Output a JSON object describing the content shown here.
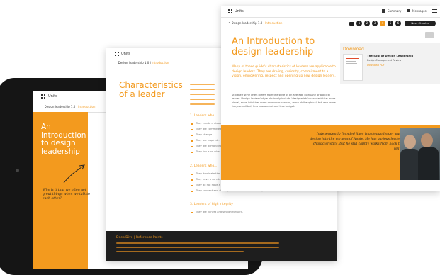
{
  "tablet": {
    "menu_label": "Units",
    "breadcrumb_course": "Design leadership 1.0",
    "breadcrumb_sep": "|",
    "breadcrumb_page": "Introduction",
    "hero_title": "An introduction to design leadership",
    "quote": "Why is it that we often get great things when we talk to each other?"
  },
  "middle": {
    "menu_label": "Units",
    "breadcrumb_course": "Design leadership 1.0",
    "breadcrumb_page": "Introduction",
    "title": "Characteristics of a leader",
    "section_1": "1. Leaders who...",
    "section_2": "2. Leaders who...",
    "section_3": "3. Leaders of high integrity",
    "footer_heading": "Deep Dive | Reference Points",
    "bullets_1": [
      "They create a vision...",
      "They are committed...",
      "They change...",
      "They are inspired...",
      "They are demanding...",
      "They focus on what..."
    ],
    "bullets_2": [
      "They dominate the...",
      "They have a can-do attitude and never shy away from a new challenge.",
      "They do not have a rigid mentality — wanting time on any things can't get done.",
      "They connect and develop with others to expand capabilities and effectiveness."
    ],
    "bullets_3": [
      "They are honest and straightforward."
    ]
  },
  "front": {
    "menu_label": "Units",
    "summary_label": "Summary",
    "messages_label": "Messages",
    "breadcrumb_course": "Design leadership 1.0",
    "breadcrumb_page": "Introduction",
    "title": "An Introduction to design leadership",
    "lead": "Many of these guide's characteristics of leaders are applicable to design leaders. They are driving, curiosity, commitment to a vision, empowering, respect and opening up new design leaders.",
    "body": "Still their style often differs from the style of an average company or political leader. Design leaders' style obviously include 'designerish' characteristics: more visual, more intuitive, more consumer-centred, more philosophical, but also more fun, committed, less economical and less budget.",
    "download_label": "Download",
    "book_title": "The Soul of Design Leadership",
    "book_sub": "Design Management Review",
    "book_link": "Download PDF",
    "next_chapter": "Next Chapter",
    "progress_steps": [
      "1",
      "2",
      "3",
      "4",
      "5",
      "6"
    ],
    "active_step": "4",
    "quote": "Independently founded lines is a design leader pushing design into the corners of Apple. He has various leadership characteristics, but he still calmly walks from back to her Jony Ive."
  },
  "colors": {
    "accent": "#f39a1e",
    "dark_panel": "#1e1e1e",
    "tablet_frame": "#141414"
  }
}
